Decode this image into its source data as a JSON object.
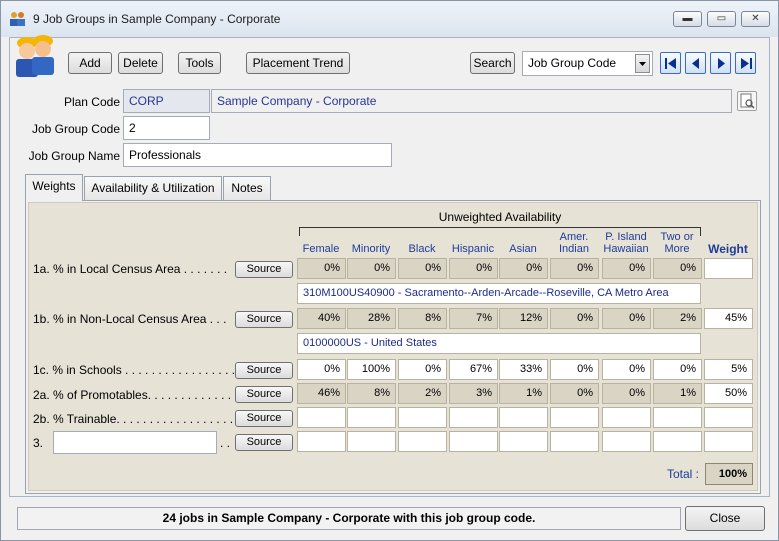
{
  "window": {
    "title": "9 Job Groups in Sample Company - Corporate",
    "controls": {
      "minimize": "▬",
      "maximize": "▭",
      "close": "✕"
    }
  },
  "toolbar": {
    "add_label": "Add",
    "delete_label": "Delete",
    "tools_label": "Tools",
    "placement_trend_label": "Placement Trend",
    "search_label": "Search",
    "search_field_value": "Job Group Code"
  },
  "form": {
    "plan_code_label": "Plan Code",
    "plan_code_value": "CORP",
    "plan_name_value": "Sample Company - Corporate",
    "job_group_code_label": "Job Group Code",
    "job_group_code_value": "2",
    "job_group_name_label": "Job Group Name",
    "job_group_name_value": "Professionals"
  },
  "tabs": [
    "Weights",
    "Availability & Utilization",
    "Notes"
  ],
  "weights": {
    "group_title": "Unweighted Availability",
    "columns": [
      "Female",
      "Minority",
      "Black",
      "Hispanic",
      "Asian",
      "Amer.\nIndian",
      "P. Island\nHawaiian",
      "Two or\nMore"
    ],
    "weight_header": "Weight",
    "source_label": "Source",
    "rows": [
      {
        "label": "1a.  % in Local Census Area  . . . . . . .",
        "values": [
          "0%",
          "0%",
          "0%",
          "0%",
          "0%",
          "0%",
          "0%",
          "0%"
        ],
        "weight": "",
        "shaded": true
      },
      {
        "label": "1b.  % in Non-Local Census Area  . . .",
        "values": [
          "40%",
          "28%",
          "8%",
          "7%",
          "12%",
          "0%",
          "0%",
          "2%"
        ],
        "weight": "45%",
        "shaded": true
      },
      {
        "label": "1c.  % in Schools . . . . . . . . . . . . . . . . .",
        "values": [
          "0%",
          "100%",
          "0%",
          "67%",
          "33%",
          "0%",
          "0%",
          "0%"
        ],
        "weight": "5%",
        "shaded": false
      },
      {
        "label": "2a.  % of Promotables. . . . . . . . . . . . . .",
        "values": [
          "46%",
          "8%",
          "2%",
          "3%",
          "1%",
          "0%",
          "0%",
          "1%"
        ],
        "weight": "50%",
        "shaded": true
      },
      {
        "label": "2b.  % Trainable. . . . . . . . . . . . . . . . . .",
        "values": [
          "",
          "",
          "",
          "",
          "",
          "",
          "",
          ""
        ],
        "weight": "",
        "shaded": false
      },
      {
        "label": "3.",
        "values": [
          "",
          "",
          "",
          "",
          "",
          "",
          "",
          ""
        ],
        "weight": "",
        "shaded": false
      }
    ],
    "area_local": "310M100US40900 - Sacramento--Arden-Arcade--Roseville, CA Metro Area",
    "area_nonlocal": "0100000US - United States",
    "row3_dots": ". .",
    "total_label": "Total :",
    "total_value": "100%"
  },
  "status_text": "24 jobs in Sample Company - Corporate with this job group code.",
  "close_label": "Close",
  "colors": {
    "accent": "#283593",
    "panel": "#e6e2d6",
    "shaded_cell": "#d9d4c4"
  }
}
